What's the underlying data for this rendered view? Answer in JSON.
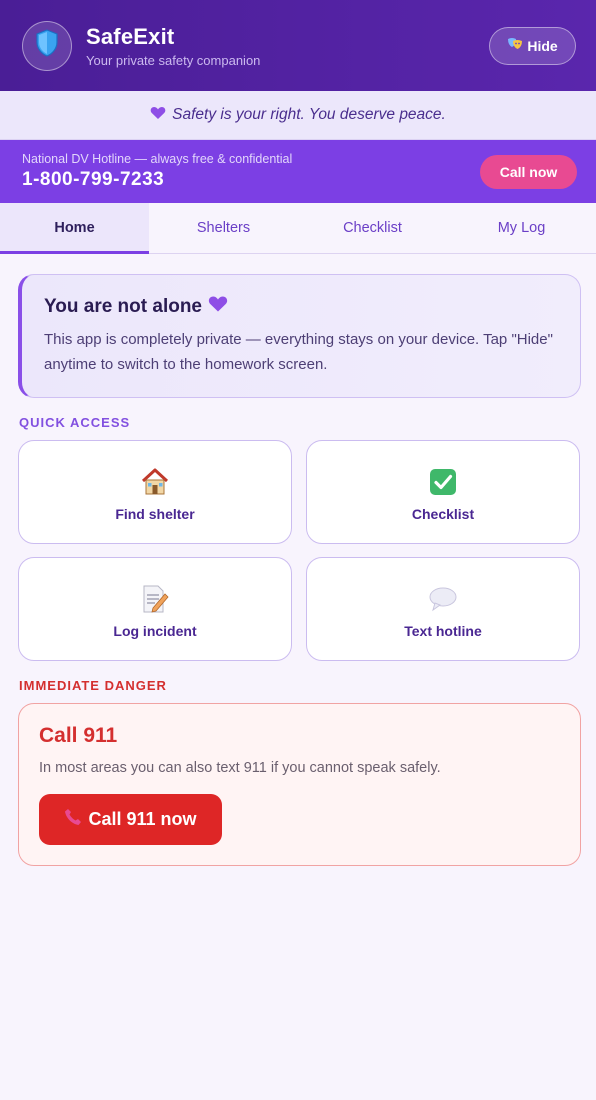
{
  "header": {
    "logo_icon": "shield-icon",
    "title": "SafeExit",
    "subtitle": "Your private safety companion",
    "hide_icon": "masks-icon",
    "hide_label": "Hide"
  },
  "affirmation": {
    "icon": "purple-heart-icon",
    "text": "Safety is your right. You deserve peace."
  },
  "hotline": {
    "label": "National DV Hotline — always free & confidential",
    "number": "1-800-799-7233",
    "call_label": "Call now"
  },
  "tabs": [
    {
      "label": "Home",
      "active": true
    },
    {
      "label": "Shelters",
      "active": false
    },
    {
      "label": "Checklist",
      "active": false
    },
    {
      "label": "My Log",
      "active": false
    }
  ],
  "intro": {
    "title": "You are not alone",
    "icon": "purple-heart-icon",
    "body": "This app is completely private — everything stays on your device. Tap \"Hide\" anytime to switch to the homework screen."
  },
  "quick_access": {
    "heading": "QUICK ACCESS",
    "items": [
      {
        "icon": "house-icon",
        "label": "Find shelter"
      },
      {
        "icon": "check-mark-icon",
        "label": "Checklist"
      },
      {
        "icon": "memo-icon",
        "label": "Log incident"
      },
      {
        "icon": "speech-bubble-icon",
        "label": "Text hotline"
      }
    ]
  },
  "danger": {
    "heading": "IMMEDIATE DANGER",
    "title": "Call 911",
    "body": "In most areas you can also text 911 if you cannot speak safely.",
    "button_icon": "phone-icon",
    "button_label": "Call 911 now"
  },
  "colors": {
    "header": "#4a1e96",
    "accent": "#7c3fe4",
    "pink": "#e84a92",
    "danger": "#de2626"
  }
}
